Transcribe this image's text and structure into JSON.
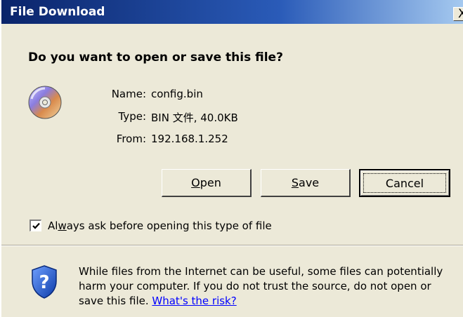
{
  "window": {
    "title": "File Download",
    "close_glyph": "X"
  },
  "prompt": {
    "question": "Do you want to open or save this file?"
  },
  "file_info": {
    "icon": "cd-disc-icon",
    "name_label": "Name:",
    "name_value": "config.bin",
    "type_label": "Type:",
    "type_value": "BIN 文件, 40.0KB",
    "from_label": "From:",
    "from_value": "192.168.1.252"
  },
  "buttons": {
    "open": {
      "mnemonic": "O",
      "rest": "pen"
    },
    "save": {
      "mnemonic": "S",
      "rest": "ave"
    },
    "cancel": {
      "label": "Cancel"
    }
  },
  "checkbox": {
    "checked": true,
    "label_before": "Al",
    "label_mnemonic": "w",
    "label_after": "ays ask before opening this type of file"
  },
  "warning": {
    "icon": "shield-question-icon",
    "text": "While files from the Internet can be useful, some files can potentially harm your computer. If you do not trust the source, do not open or save this file. ",
    "link": "What's the risk?"
  },
  "colors": {
    "title_bar_start": "#0a246a",
    "title_bar_end": "#a6caf0",
    "dialog_bg": "#ece9d8",
    "link": "#0000ff"
  }
}
